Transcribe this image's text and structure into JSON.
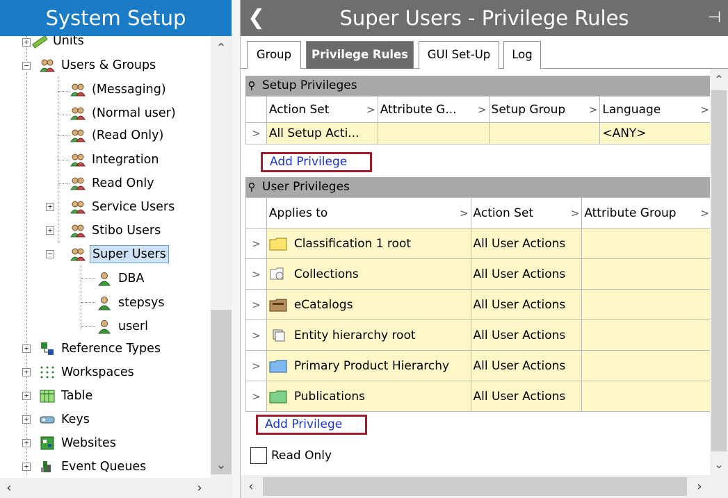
{
  "left_panel": {
    "title": "System Setup",
    "tree": [
      {
        "label": "Units",
        "icon": "ruler-icon"
      },
      {
        "label": "Users & Groups",
        "icon": "user-group-icon"
      },
      {
        "label": "(Messaging)",
        "icon": "user-group-icon"
      },
      {
        "label": "(Normal user)",
        "icon": "user-group-icon"
      },
      {
        "label": "(Read Only)",
        "icon": "user-group-icon"
      },
      {
        "label": "Integration",
        "icon": "user-group-icon"
      },
      {
        "label": "Read Only",
        "icon": "user-group-icon"
      },
      {
        "label": "Service Users",
        "icon": "user-group-icon"
      },
      {
        "label": "Stibo Users",
        "icon": "user-group-icon"
      },
      {
        "label": "Super Users",
        "icon": "user-group-icon",
        "selected": true
      },
      {
        "label": "DBA",
        "icon": "user-icon"
      },
      {
        "label": "stepsys",
        "icon": "user-icon"
      },
      {
        "label": "userl",
        "icon": "user-icon"
      },
      {
        "label": "Reference Types",
        "icon": "reference-types-icon"
      },
      {
        "label": "Workspaces",
        "icon": "workspaces-icon"
      },
      {
        "label": "Table",
        "icon": "table-icon"
      },
      {
        "label": "Keys",
        "icon": "keys-icon"
      },
      {
        "label": "Websites",
        "icon": "websites-icon"
      },
      {
        "label": "Event Queues",
        "icon": "event-queues-icon"
      }
    ]
  },
  "right_panel": {
    "title": "Super Users - Privilege Rules",
    "back_glyph": "❮",
    "pin_glyph": "⊣",
    "tabs": [
      {
        "label": "Group",
        "active": false
      },
      {
        "label": "Privilege Rules",
        "active": true
      },
      {
        "label": "GUI Set-Up",
        "active": false
      },
      {
        "label": "Log",
        "active": false
      }
    ],
    "setup_privileges": {
      "header": "Setup Privileges",
      "columns": [
        "Action Set",
        "Attribute G...",
        "Setup Group",
        "Language"
      ],
      "rows": [
        [
          "All Setup Acti...",
          "",
          "",
          "<ANY>"
        ]
      ],
      "add_label": "Add Privilege"
    },
    "user_privileges": {
      "header": "User Privileges",
      "columns": [
        "Applies to",
        "Action Set",
        "Attribute Group"
      ],
      "rows": [
        {
          "applies_to": "Classification 1 root",
          "icon": "classification-folder-icon",
          "action_set": "All User Actions",
          "attribute_group": ""
        },
        {
          "applies_to": "Collections",
          "icon": "collections-icon",
          "action_set": "All User Actions",
          "attribute_group": ""
        },
        {
          "applies_to": "eCatalogs",
          "icon": "ecatalogs-folder-icon",
          "action_set": "All User Actions",
          "attribute_group": ""
        },
        {
          "applies_to": "Entity hierarchy root",
          "icon": "entity-hierarchy-icon",
          "action_set": "All User Actions",
          "attribute_group": ""
        },
        {
          "applies_to": "Primary Product Hierarchy",
          "icon": "product-folder-icon",
          "action_set": "All User Actions",
          "attribute_group": ""
        },
        {
          "applies_to": "Publications",
          "icon": "publications-folder-icon",
          "action_set": "All User Actions",
          "attribute_group": ""
        }
      ],
      "add_label": "Add Privilege"
    },
    "read_only_label": "Read Only",
    "read_only_checked": false
  },
  "colors": {
    "left_title_bg": "#1a7cc7",
    "right_title_bg": "#6e6e6e",
    "row_bg": "#fff7c8",
    "add_border": "#a11c2d",
    "link_color": "#1a35cc"
  }
}
